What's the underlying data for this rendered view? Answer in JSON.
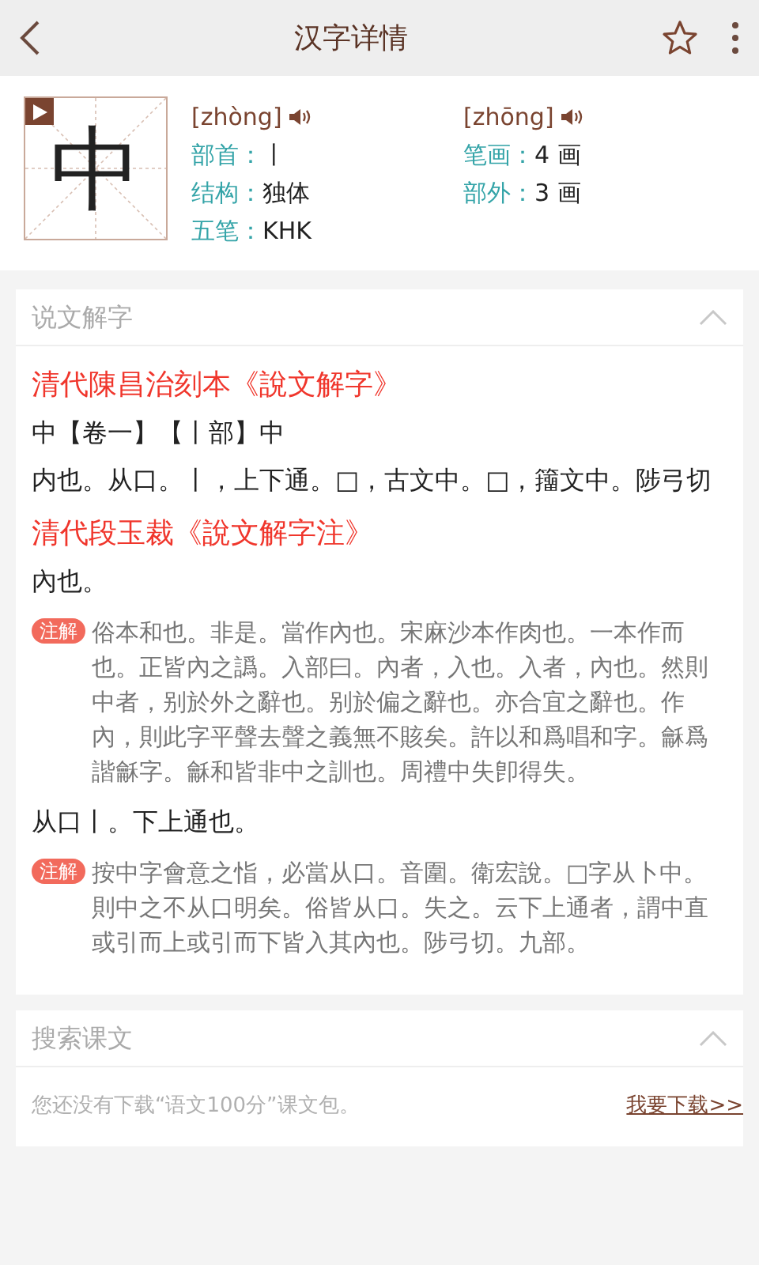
{
  "header": {
    "title": "汉字详情",
    "favorite": false
  },
  "character": {
    "glyph": "中",
    "pronunciations": [
      {
        "pinyin": "[zhòng]"
      },
      {
        "pinyin": "[zhōng]"
      }
    ],
    "fields": [
      {
        "label": "部首：",
        "value": "丨"
      },
      {
        "label": "笔画：",
        "value": "4 画"
      },
      {
        "label": "结构：",
        "value": "独体"
      },
      {
        "label": "部外：",
        "value": "3 画"
      },
      {
        "label": "五笔：",
        "value": "KHK"
      }
    ]
  },
  "shuowen": {
    "title": "说文解字",
    "expanded": true,
    "blocks": [
      {
        "kind": "source",
        "text": "清代陳昌治刻本《說文解字》"
      },
      {
        "kind": "text",
        "text": "中【卷一】【丨部】中"
      },
      {
        "kind": "text",
        "text": "内也。从口。丨，上下通。□，古文中。□，籒文中。陟弓切"
      },
      {
        "kind": "source",
        "text": "清代段玉裁《說文解字注》"
      },
      {
        "kind": "text",
        "text": "內也。"
      },
      {
        "kind": "note",
        "badge": "注解",
        "text": "俗本和也。非是。當作內也。宋麻沙本作肉也。一本作而也。正皆內之譌。入部曰。內者，入也。入者，內也。然則中者，别於外之辭也。别於偏之辭也。亦合宜之辭也。作內，則此字平聲去聲之義無不賅矣。許以和爲唱和字。龢爲諧龢字。龢和皆非中之訓也。周禮中失卽得失。"
      },
      {
        "kind": "text",
        "text": "从口丨。下上通也。"
      },
      {
        "kind": "note",
        "badge": "注解",
        "text": "按中字會意之恉，必當从口。音圍。衛宏說。□字从卜中。則中之不从口明矣。俗皆从口。失之。云下上通者，謂中直或引而上或引而下皆入其內也。陟弓切。九部。"
      }
    ]
  },
  "lessons": {
    "title": "搜索课文",
    "expanded": true,
    "message": "您还没有下载“语文100分”课文包。",
    "link": "我要下载>>"
  }
}
